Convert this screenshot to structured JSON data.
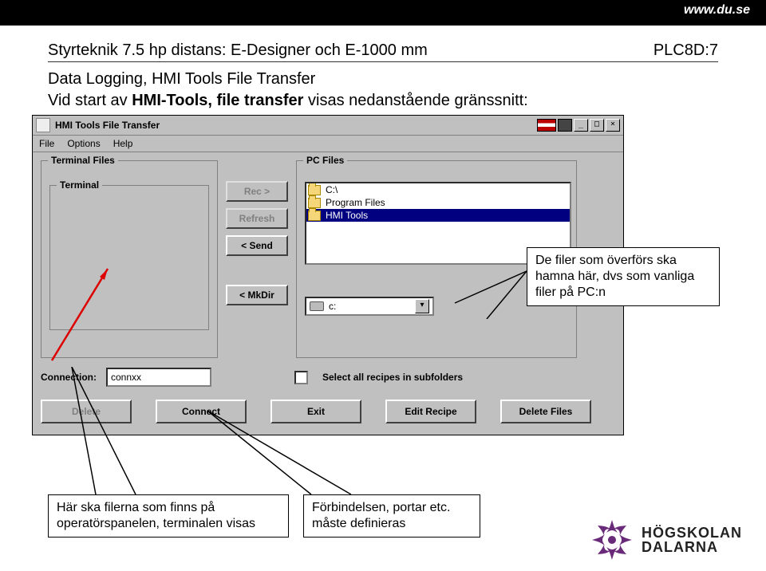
{
  "site_url": "www.du.se",
  "header": {
    "left": "Styrteknik 7.5 hp distans: E-Designer och E-1000 mm",
    "right": "PLC8D:7"
  },
  "section_title": "Data Logging, HMI Tools File Transfer",
  "intro_prefix": "Vid start av ",
  "intro_bold": "HMI-Tools, file transfer",
  "intro_suffix": " visas nedanstående gränssnitt:",
  "window": {
    "title": "HMI Tools File Transfer",
    "menu": {
      "file": "File",
      "options": "Options",
      "help": "Help"
    },
    "left_panel": {
      "title": "Terminal Files",
      "inner": "Terminal"
    },
    "mid_buttons": {
      "rec": "Rec >",
      "refresh": "Refresh",
      "send": "< Send",
      "mkdir": "< MkDir"
    },
    "right_panel": {
      "title": "PC Files",
      "rows": [
        "C:\\",
        "Program Files",
        "HMI Tools"
      ],
      "drive": "c:"
    },
    "connection": {
      "label": "Connection:",
      "value": "connxx"
    },
    "select_all": "Select all recipes in subfolders",
    "bottom": {
      "delete": "Delete",
      "connect": "Connect",
      "exit": "Exit",
      "edit": "Edit Recipe",
      "delfiles": "Delete Files"
    }
  },
  "callouts": {
    "right": "De filer som överförs ska hamna här, dvs som vanliga filer på PC:n",
    "bottom_left": "Här ska filerna som finns på operatörspanelen, terminalen visas",
    "bottom_mid": "Förbindelsen, portar etc. måste definieras"
  },
  "logo": {
    "line1": "HÖGSKOLAN",
    "line2": "DALARNA"
  }
}
